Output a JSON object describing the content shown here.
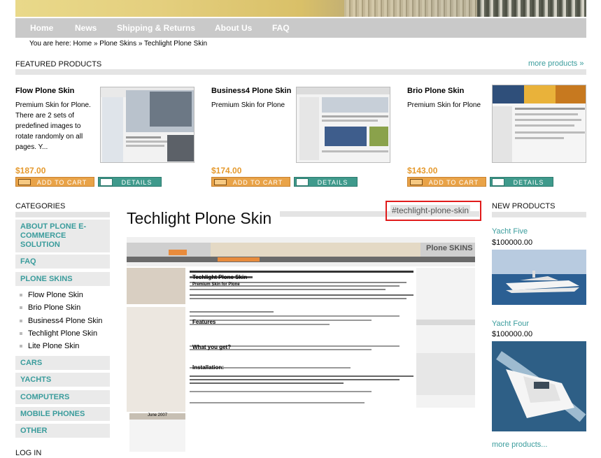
{
  "nav": {
    "items": [
      "Home",
      "News",
      "Shipping & Returns",
      "About Us",
      "FAQ"
    ]
  },
  "breadcrumb": {
    "prefix": "You are here:",
    "home": "Home",
    "sep": "»",
    "section": "Plone Skins",
    "current": "Techlight Plone Skin"
  },
  "featured": {
    "title": "FEATURED PRODUCTS",
    "more": "more products »",
    "add_to_cart": "ADD TO CART",
    "details": "DETAILS",
    "products": [
      {
        "name": "Flow Plone Skin",
        "desc": "Premium Skin for Plone. There are 2 sets of predefined images to rotate randomly on all pages. Y...",
        "price": "$187.00"
      },
      {
        "name": "Business4 Plone Skin",
        "desc": "Premium Skin for Plone",
        "price": "$174.00"
      },
      {
        "name": "Brio Plone Skin",
        "desc": "Premium Skin for Plone",
        "price": "$143.00"
      }
    ]
  },
  "categories": {
    "title": "CATEGORIES",
    "about": "ABOUT PLONE E-COMMERCE SOLUTION",
    "faq": "FAQ",
    "plone_skins": "PLONE SKINS",
    "skins": [
      "Flow Plone Skin",
      "Brio Plone Skin",
      "Business4 Plone Skin",
      "Techlight Plone Skin",
      "Lite Plone Skin"
    ],
    "cars": "CARS",
    "yachts": "YACHTS",
    "computers": "COMPUTERS",
    "mobile_phones": "MOBILE PHONES",
    "other": "OTHER"
  },
  "login": {
    "title": "LOG IN"
  },
  "main": {
    "title": "Techlight Plone Skin",
    "tag": "#techlight-plone-skin",
    "preview": {
      "heading": "Techlight Plone Skin",
      "subheading": "Premium Skin for Plone",
      "features": "Features",
      "what_you_get": "What you get?",
      "installation": "Installation:",
      "calendar_month": "June 2007",
      "brand": "Plone SKINS"
    }
  },
  "new_products": {
    "title": "NEW PRODUCTS",
    "items": [
      {
        "name": "Yacht Five",
        "price": "$100000.00"
      },
      {
        "name": "Yacht Four",
        "price": "$100000.00"
      }
    ],
    "more": "more products..."
  }
}
